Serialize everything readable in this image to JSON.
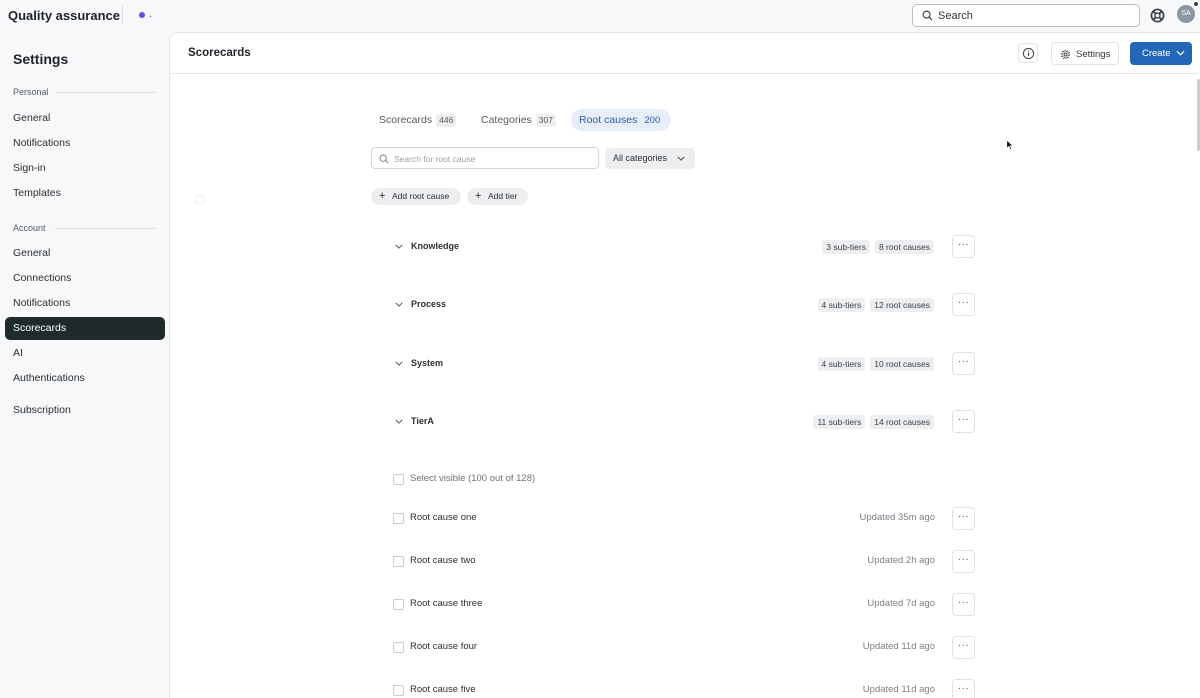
{
  "topbar": {
    "app_title": "Quality assurance",
    "dot_text": ".",
    "search_placeholder": "Search",
    "avatar_initials": "SA"
  },
  "sidebar": {
    "title": "Settings",
    "sections": [
      {
        "label": "Personal",
        "items": [
          "General",
          "Notifications",
          "Sign-in",
          "Templates"
        ]
      },
      {
        "label": "Account",
        "items": [
          "General",
          "Connections",
          "Notifications",
          "Scorecards",
          "AI",
          "Authentications"
        ]
      }
    ],
    "extra_item": "Subscription",
    "active_item": "Scorecards"
  },
  "header": {
    "title": "Scorecards",
    "settings_label": "Settings",
    "create_label": "Create"
  },
  "tabs": [
    {
      "label": "Scorecards",
      "count": "446",
      "active": false
    },
    {
      "label": "Categories",
      "count": "307",
      "active": false
    },
    {
      "label": "Root causes",
      "count": "200",
      "active": true
    }
  ],
  "filters": {
    "search_placeholder": "Search for root cause",
    "category_select": "All categories"
  },
  "actions": {
    "add_root_cause": "Add root cause",
    "add_tier": "Add tier"
  },
  "tiers": [
    {
      "name": "Knowledge",
      "sub_tiers": "3 sub-tiers",
      "root_causes": "8 root causes"
    },
    {
      "name": "Process",
      "sub_tiers": "4 sub-tiers",
      "root_causes": "12 root causes"
    },
    {
      "name": "System",
      "sub_tiers": "4 sub-tiers",
      "root_causes": "10 root causes"
    },
    {
      "name": "TierA",
      "sub_tiers": "11 sub-tiers",
      "root_causes": "14 root causes"
    }
  ],
  "select_visible": "Select visible (100 out of 128)",
  "root_causes": [
    {
      "name": "Root cause one",
      "updated": "Updated 35m ago"
    },
    {
      "name": "Root cause two",
      "updated": "Updated 2h ago"
    },
    {
      "name": "Root cause three",
      "updated": "Updated 7d ago"
    },
    {
      "name": "Root cause four",
      "updated": "Updated 11d ago"
    },
    {
      "name": "Root cause five",
      "updated": "Updated 11d ago"
    }
  ],
  "more_glyph": "···",
  "colors": {
    "accent": "#2466b8",
    "active_nav": "#1f2b2b",
    "active_tab_bg": "#e8eef8",
    "brand_dot": "#6b4fd8"
  }
}
